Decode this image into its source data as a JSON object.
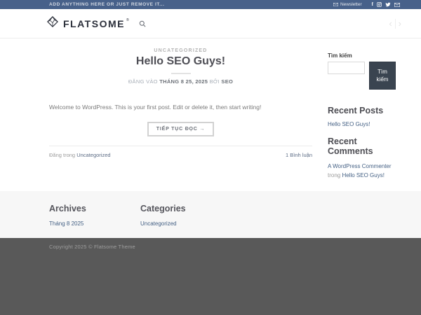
{
  "topbar": {
    "left_text": "ADD ANYTHING HERE OR JUST REMOVE IT...",
    "newsletter_label": "Newsletter",
    "social_icons": [
      "facebook",
      "instagram",
      "twitter",
      "email"
    ]
  },
  "header": {
    "logo_text": "FLATSOME",
    "logo_reg": "®",
    "nav_prev": "‹",
    "nav_next": "›"
  },
  "post": {
    "category": "UNCATEGORIZED",
    "title": "Hello SEO Guys!",
    "meta_prefix": "ĐĂNG VÀO",
    "meta_date": "THÁNG 8 25, 2025",
    "meta_by": "BỞI",
    "meta_author": "SEO",
    "excerpt": "Welcome to WordPress. This is your first post. Edit or delete it, then start writing!",
    "read_more_label": "TIẾP TỤC ĐỌC →",
    "posted_in_label": "Đăng trong",
    "category_link": "Uncategorized",
    "comments_link": "1 Bình luận"
  },
  "sidebar": {
    "search": {
      "label": "Tìm kiếm",
      "input_value": "",
      "button_label": "Tìm kiếm"
    },
    "recent_posts": {
      "title": "Recent Posts",
      "items": [
        "Hello SEO Guys!"
      ]
    },
    "recent_comments": {
      "title": "Recent Comments",
      "items": [
        {
          "author": "A WordPress Commenter",
          "connector": "trong",
          "post": "Hello SEO Guys!"
        }
      ]
    }
  },
  "footer": {
    "archives": {
      "title": "Archives",
      "items": [
        "Tháng 8 2025"
      ]
    },
    "categories": {
      "title": "Categories",
      "items": [
        "Uncategorized"
      ]
    },
    "copyright": "Copyright 2025 © Flatsome Theme"
  },
  "colors": {
    "accent": "#446084",
    "topbar_bg": "#47618a",
    "search_button_bg": "#3a4450",
    "footer_bg": "#f7f7f7",
    "absolute_footer_bg": "#595959"
  }
}
